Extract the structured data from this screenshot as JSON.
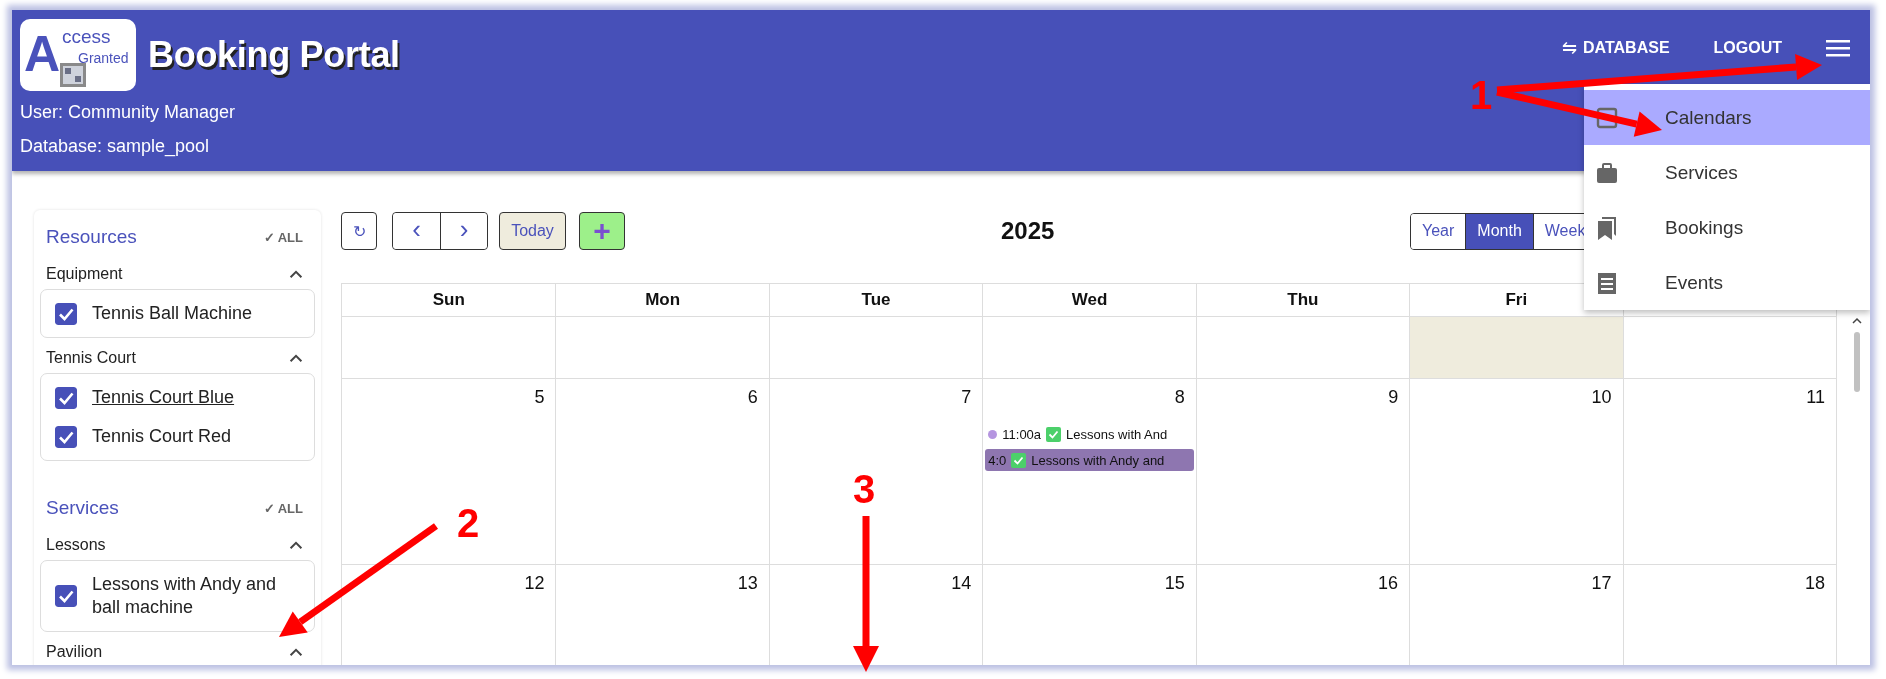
{
  "header": {
    "logo": {
      "letter": "A",
      "line1": "ccess",
      "line2": "Granted"
    },
    "title": "Booking Portal",
    "user": "User: Community Manager",
    "database": "Database: sample_pool",
    "database_button": {
      "icon": "⇋",
      "label": "DATABASE"
    },
    "logout_button": "LOGOUT"
  },
  "menu": [
    {
      "label": "Calendars",
      "selected": true
    },
    {
      "label": "Services",
      "selected": false
    },
    {
      "label": "Bookings",
      "selected": false
    },
    {
      "label": "Events",
      "selected": false
    }
  ],
  "sidebar": [
    {
      "title": "Resources",
      "all": "✓ ALL",
      "groups": [
        {
          "label": "Equipment",
          "expanded": true,
          "items": [
            {
              "label": "Tennis Ball Machine",
              "checked": true,
              "hovered": false
            }
          ]
        },
        {
          "label": "Tennis Court",
          "expanded": true,
          "items": [
            {
              "label": "Tennis Court Blue",
              "checked": true,
              "hovered": true
            },
            {
              "label": "Tennis Court Red",
              "checked": true,
              "hovered": false
            }
          ]
        }
      ]
    },
    {
      "title": "Services",
      "all": "✓ ALL",
      "groups": [
        {
          "label": "Lessons",
          "expanded": true,
          "items": [
            {
              "label": "Lessons with Andy and ball machine",
              "checked": true,
              "hovered": false
            }
          ]
        },
        {
          "label": "Pavilion",
          "expanded": true
        }
      ]
    }
  ],
  "toolbar": {
    "refresh": "↻",
    "prev": "‹",
    "next": "›",
    "today": "Today",
    "add": "+",
    "title": "2025",
    "views": [
      {
        "label": "Year",
        "selected": false
      },
      {
        "label": "Month",
        "selected": true
      },
      {
        "label": "Week",
        "selected": false
      }
    ]
  },
  "weekdays": [
    "Sun",
    "Mon",
    "Tue",
    "Wed",
    "Thu",
    "Fri"
  ],
  "weeks": [
    {
      "cells": [
        {
          "today": false
        },
        {
          "today": false
        },
        {
          "today": false
        },
        {
          "today": false
        },
        {
          "today": false
        },
        {
          "today": true
        },
        {
          "today": false
        }
      ]
    },
    {
      "cells": [
        {
          "date": "5",
          "today": false
        },
        {
          "date": "6",
          "today": false
        },
        {
          "date": "7",
          "today": false
        },
        {
          "date": "8",
          "today": false,
          "events": [
            {
              "kind": "dot",
              "color": "#b595e0",
              "time": "11:00a",
              "confirmed": true,
              "title": "Lessons with And"
            },
            {
              "kind": "block",
              "color": "#8e76b0",
              "time": "4:0",
              "confirmed": true,
              "title": "Lessons with Andy and"
            }
          ]
        },
        {
          "date": "9",
          "today": false
        },
        {
          "date": "10",
          "today": false
        },
        {
          "date": "11",
          "today": false
        }
      ]
    },
    {
      "cells": [
        {
          "date": "12",
          "today": false
        },
        {
          "date": "13",
          "today": false
        },
        {
          "date": "14",
          "today": false
        },
        {
          "date": "15",
          "today": false
        },
        {
          "date": "16",
          "today": false
        },
        {
          "date": "17",
          "today": false
        },
        {
          "date": "18",
          "today": false
        }
      ]
    }
  ],
  "annotations": [
    {
      "label": "1"
    },
    {
      "label": "2"
    },
    {
      "label": "3"
    }
  ]
}
